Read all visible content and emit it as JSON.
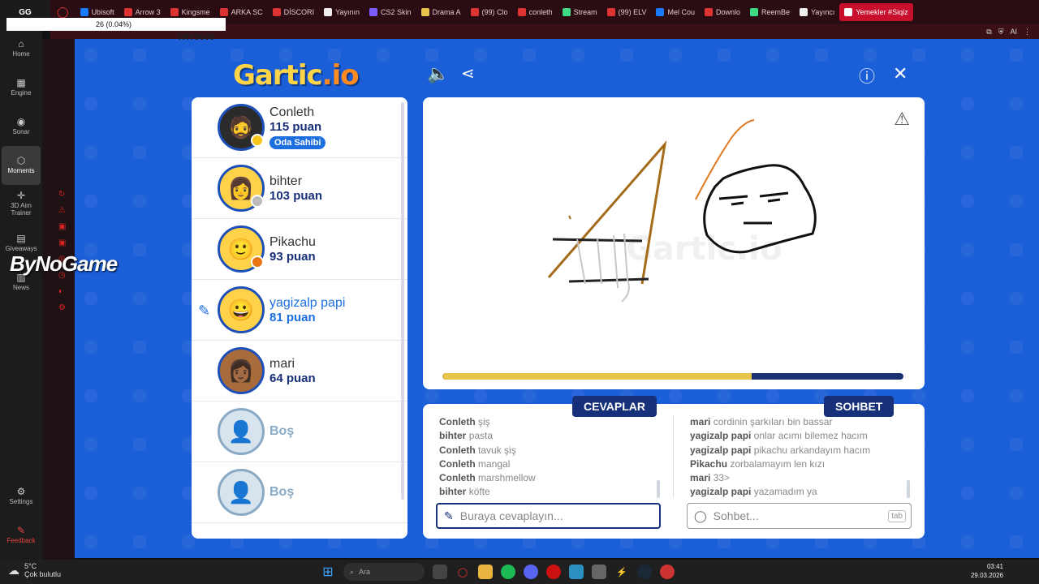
{
  "browser": {
    "gg_label": "GG",
    "tabs": [
      {
        "label": "Ubisoft",
        "color": "#1a7aff"
      },
      {
        "label": "Arrow 3",
        "color": "#d33"
      },
      {
        "label": "Kingsme",
        "color": "#d33"
      },
      {
        "label": "ARKA SC",
        "color": "#d33"
      },
      {
        "label": "DİSCORI",
        "color": "#d33"
      },
      {
        "label": "Yayının",
        "color": "#eee"
      },
      {
        "label": "CS2 Skin",
        "color": "#7a5cff"
      },
      {
        "label": "Drama A",
        "color": "#e9c44a"
      },
      {
        "label": "(99) Clo",
        "color": "#d33"
      },
      {
        "label": "conleth",
        "color": "#d33"
      },
      {
        "label": "Stream",
        "color": "#3ddc84"
      },
      {
        "label": "(99) ELV",
        "color": "#d33"
      },
      {
        "label": "Mel Cou",
        "color": "#1a7aff"
      },
      {
        "label": "Downlo",
        "color": "#d33"
      },
      {
        "label": "ReemBe",
        "color": "#3ddc84"
      },
      {
        "label": "Yayıncı",
        "color": "#eee"
      },
      {
        "label": "Yemekler #Siqiz",
        "color": "#fff",
        "active": true
      }
    ],
    "overlay_text": "26 (0.04%)",
    "top_number": "TRY5000",
    "ai_label": "AI"
  },
  "sidebar": {
    "items": [
      {
        "label": "Home",
        "icon": "home-icon"
      },
      {
        "label": "Engine",
        "icon": "chip-icon"
      },
      {
        "label": "Sonar",
        "icon": "sonar-icon"
      },
      {
        "label": "Moments",
        "icon": "moments-icon",
        "active": true
      },
      {
        "label": "3D Aim Trainer",
        "icon": "aim-icon"
      },
      {
        "label": "Giveaways",
        "icon": "gift-icon"
      },
      {
        "label": "News",
        "icon": "news-icon"
      }
    ],
    "settings_label": "Settings",
    "feedback_label": "Feedback",
    "overlay_brand": "ByNoGame"
  },
  "game": {
    "logo_main": "Gartic",
    "logo_suffix": ".io",
    "players": [
      {
        "name": "Conleth",
        "score": "115 puan",
        "badge": "Oda Sahibi",
        "dot": "#f5c518",
        "face": "🧔",
        "bg": "#2b2b2b"
      },
      {
        "name": "bihter",
        "score": "103 puan",
        "dot": "#bbbbbb",
        "face": "👩",
        "bg": "#ffd24a"
      },
      {
        "name": "Pikachu",
        "score": "93 puan",
        "dot": "#e87512",
        "face": "🙂",
        "bg": "#ffd24a"
      },
      {
        "name": "yagizalp papi",
        "score": "81 puan",
        "drawing": true,
        "face": "😀",
        "bg": "#ffd24a"
      },
      {
        "name": "mari",
        "score": "64 puan",
        "face": "👩🏾",
        "bg": "#a86b3c"
      },
      {
        "name": "Boş",
        "empty": true
      },
      {
        "name": "Boş",
        "empty": true
      }
    ],
    "progress": 0.67,
    "colors": {
      "panel_blue": "#16307a",
      "accent": "#1d6fe0",
      "bg": "#1a5ed8"
    }
  },
  "answers": {
    "title": "CEVAPLAR",
    "items": [
      {
        "user": "Conleth",
        "text": "şiş"
      },
      {
        "user": "bihter",
        "text": "pasta"
      },
      {
        "user": "Conleth",
        "text": "tavuk şiş"
      },
      {
        "user": "Conleth",
        "text": "mangal"
      },
      {
        "user": "Conleth",
        "text": "marshmellow"
      },
      {
        "user": "bihter",
        "text": "köfte"
      }
    ],
    "placeholder": "Buraya cevaplayın..."
  },
  "chat": {
    "title": "SOHBET",
    "items": [
      {
        "user": "mari",
        "text": "cordinin şarkıları bin bassar"
      },
      {
        "user": "yagizalp papi",
        "text": "onlar acımı bilemez hacım"
      },
      {
        "user": "yagizalp papi",
        "text": "pikachu arkandayım hacım"
      },
      {
        "user": "Pikachu",
        "text": "zorbalamayım len kızı"
      },
      {
        "user": "mari",
        "text": "33>"
      },
      {
        "user": "yagizalp papi",
        "text": "yazamadım ya"
      }
    ],
    "placeholder": "Sohbet...",
    "tab_hint": "tab"
  },
  "taskbar": {
    "temp": "5°C",
    "weather": "Çok bulutlu",
    "search_label": "Ara",
    "time": "03:41",
    "date": "29.03.2026"
  }
}
